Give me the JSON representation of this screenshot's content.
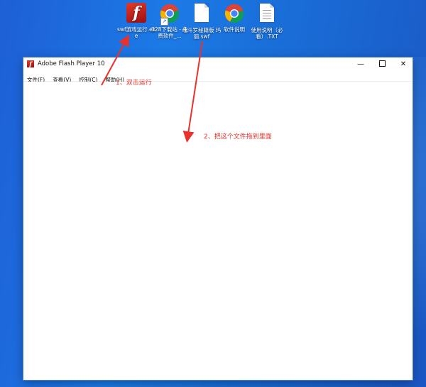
{
  "desktop": {
    "icons": [
      {
        "name": "flash-exe",
        "label": "swf游戏运行.exe",
        "glyph": "f"
      },
      {
        "name": "chrome-shortcut-1",
        "label": "328下载站 - 免费软件_...",
        "shortcut": "↗"
      },
      {
        "name": "swf-file",
        "label": "魂斗罗秘籍版 玛丽.swf"
      },
      {
        "name": "chrome-shortcut-2",
        "label": "软件说明"
      },
      {
        "name": "txt-file",
        "label": "使用说明（必看）.TXT"
      }
    ]
  },
  "window": {
    "title": "Adobe Flash Player 10",
    "app_icon_glyph": "f",
    "controls": {
      "minimize": "—",
      "close": "✕"
    },
    "menu": [
      "文件(F)",
      "查看(V)",
      "控制(C)",
      "帮助(H)"
    ]
  },
  "annotations": {
    "step1": "1、双击运行",
    "step2": "2、把这个文件拖到里面",
    "color": "#e8322b"
  }
}
